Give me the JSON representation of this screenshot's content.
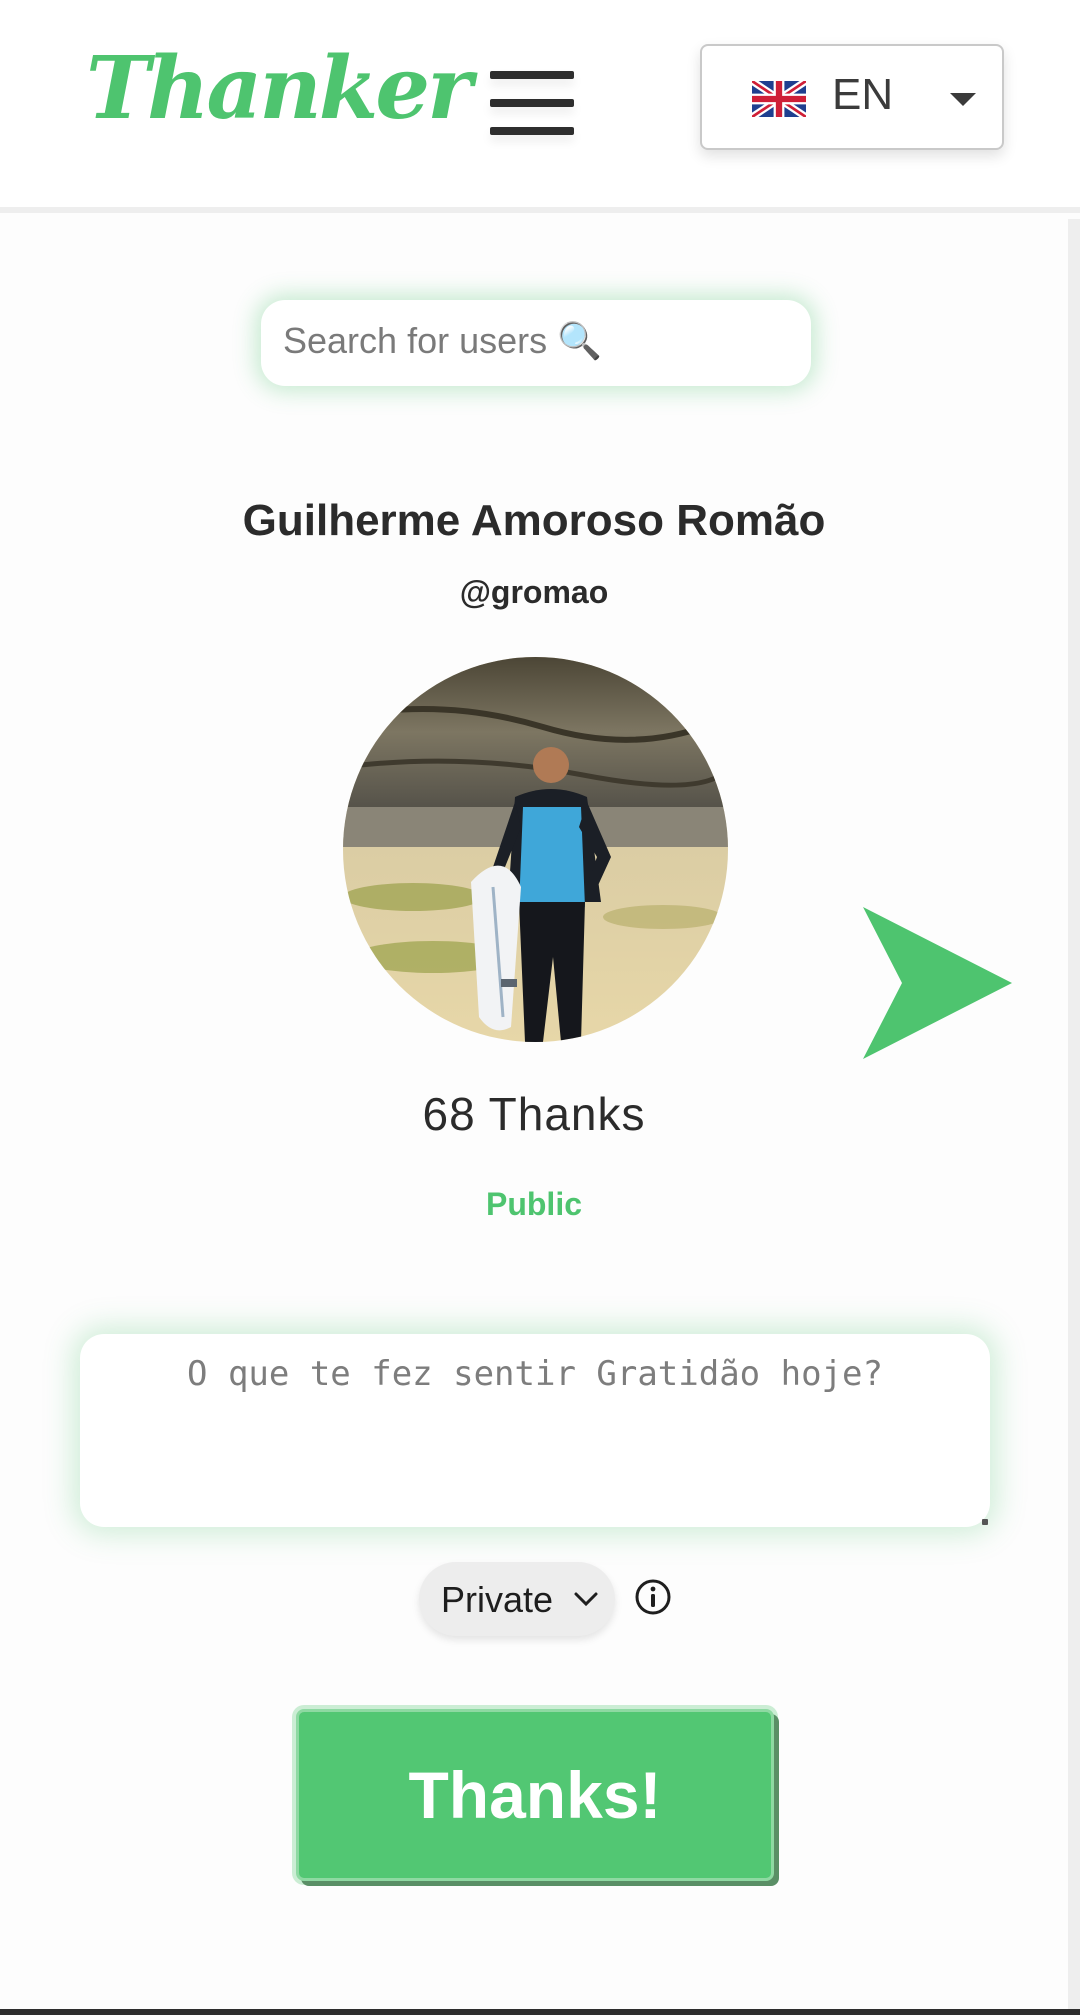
{
  "header": {
    "logo_text": "Thanker",
    "language": {
      "code": "EN",
      "flag": "uk-flag-icon"
    }
  },
  "search": {
    "placeholder": "Search for users 🔍",
    "icon": "magnifier-icon"
  },
  "profile": {
    "full_name": "Guilherme Amoroso Romão",
    "username": "@gromao",
    "thanks_count": "68 Thanks",
    "visibility": "Public"
  },
  "compose": {
    "placeholder": "O que te fez sentir Gratidão hoje?",
    "privacy_selected": "Private",
    "submit_label": "Thanks!"
  },
  "colors": {
    "accent": "#4ec46f",
    "button": "#52c773"
  }
}
